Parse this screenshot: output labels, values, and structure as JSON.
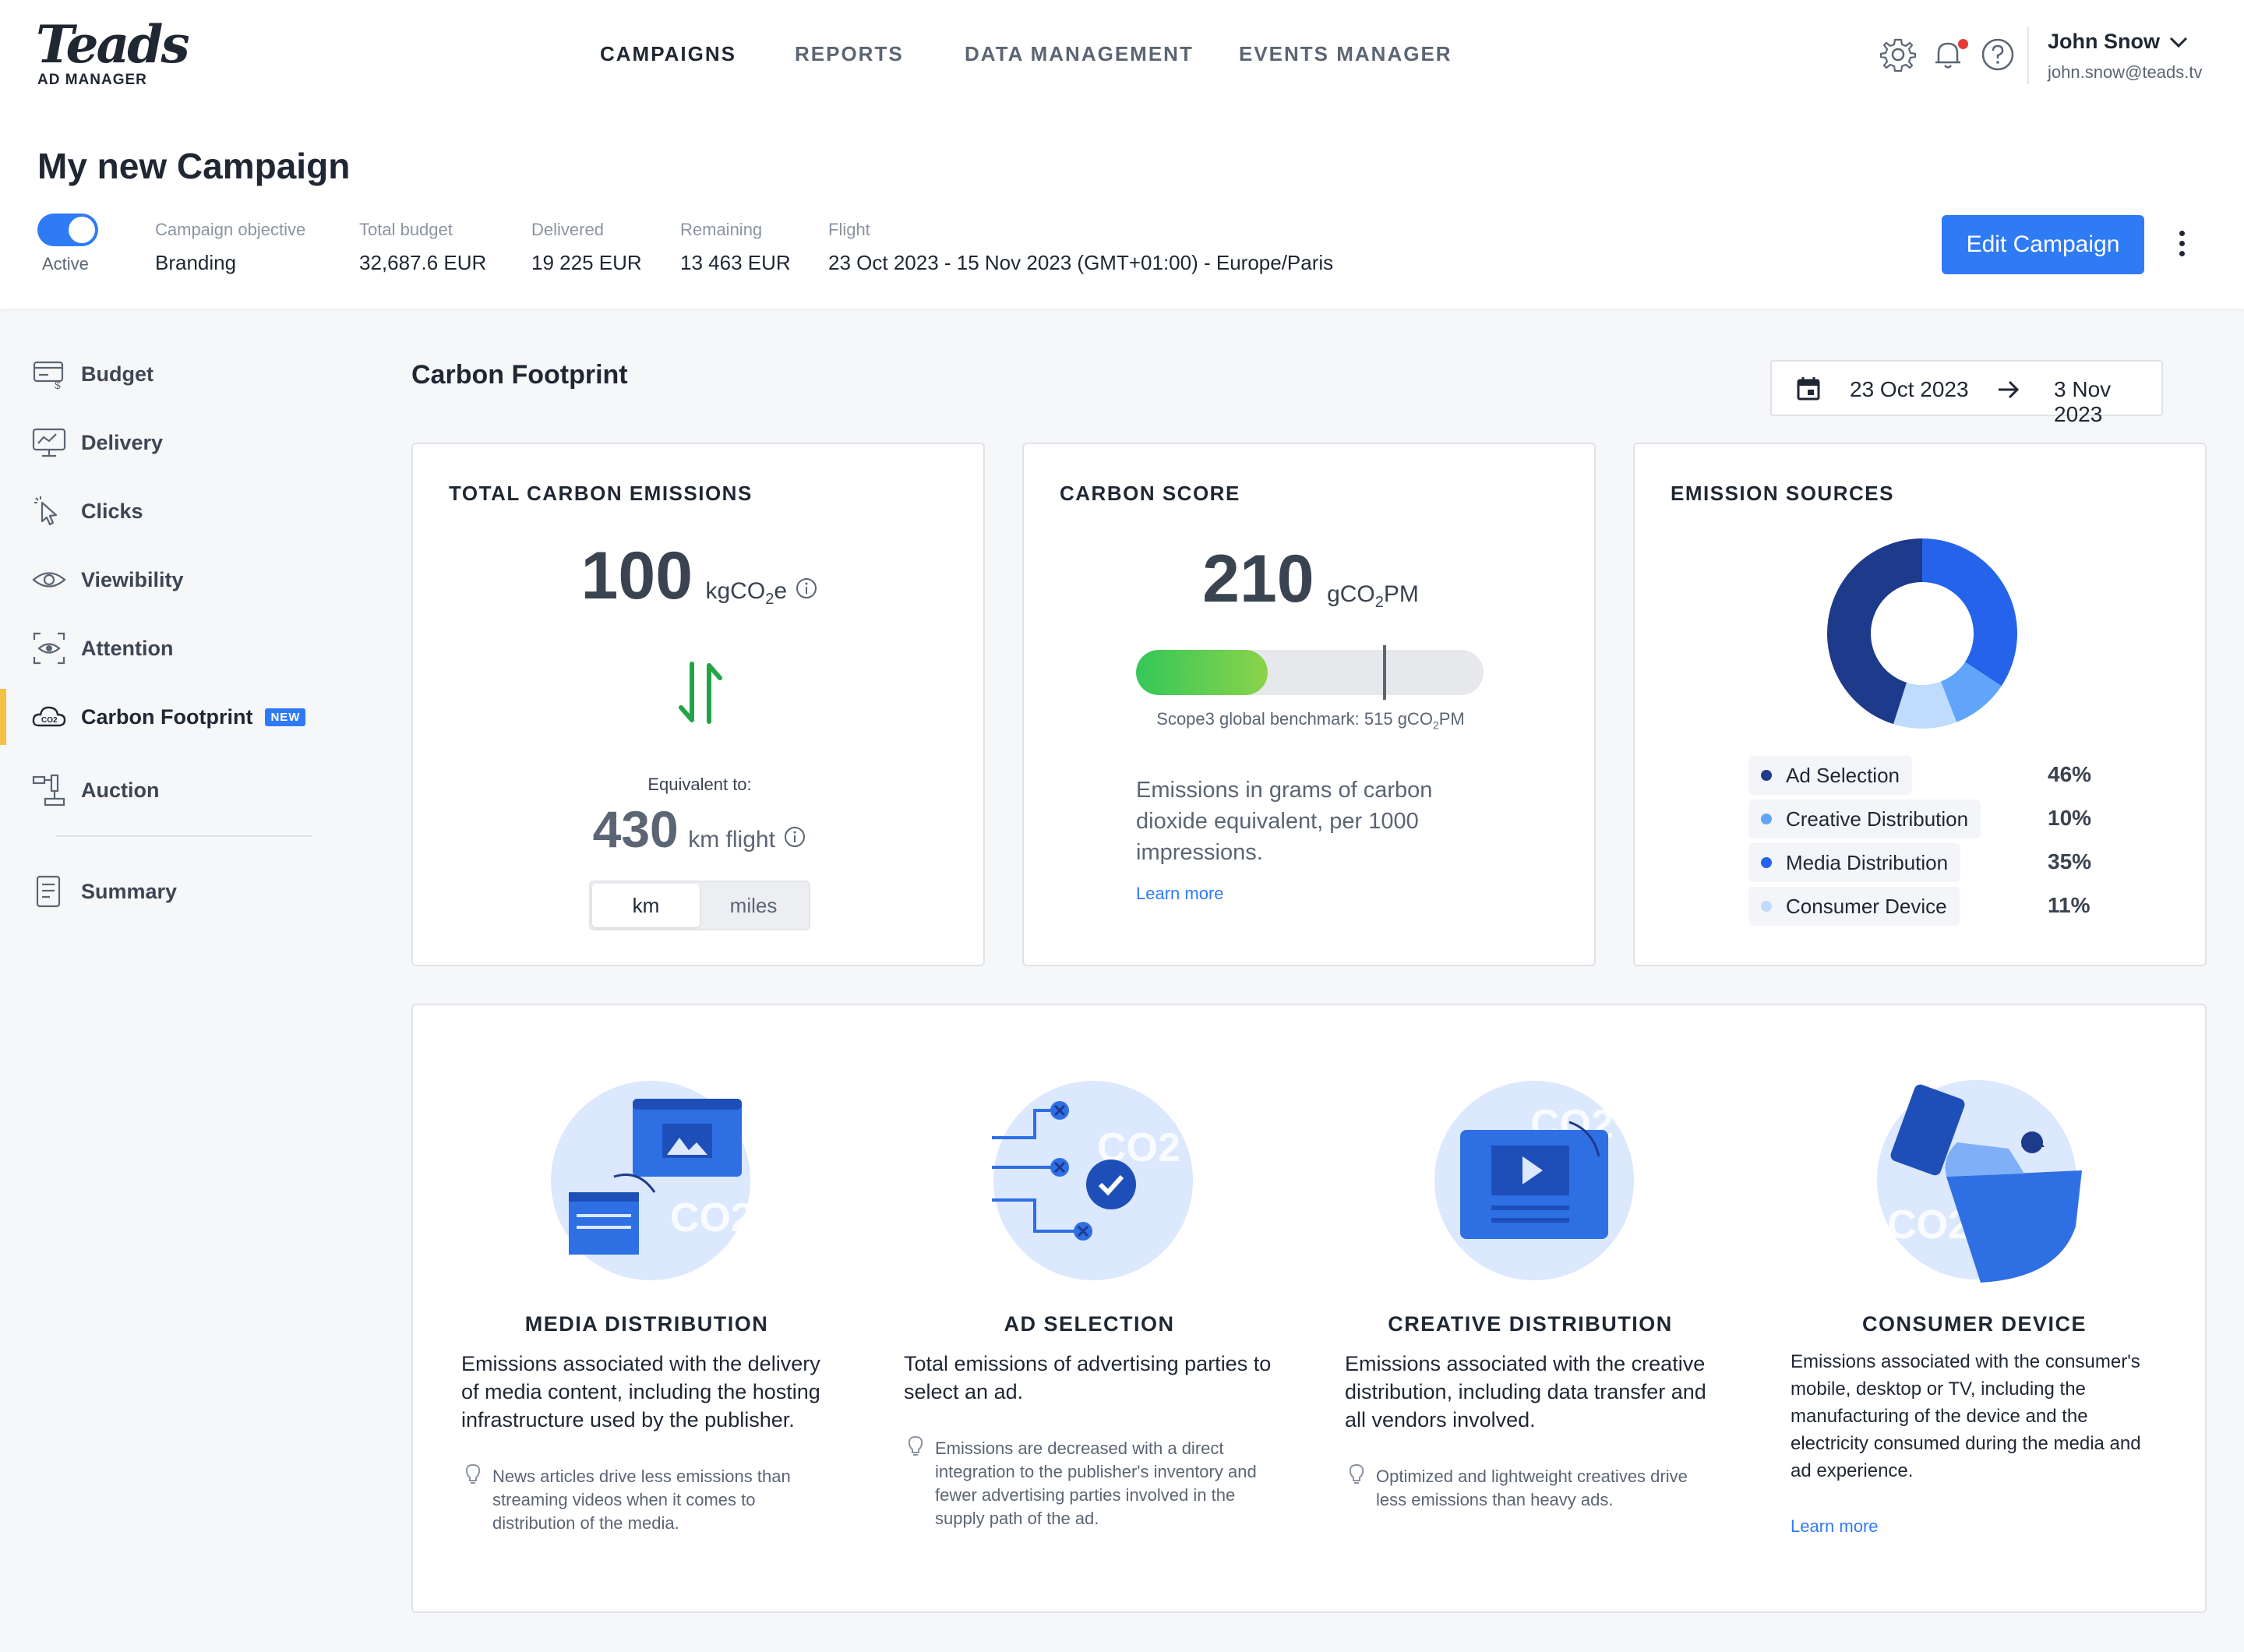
{
  "brand": {
    "logo": "Teads",
    "sub": "AD MANAGER"
  },
  "nav": {
    "items": [
      "CAMPAIGNS",
      "REPORTS",
      "DATA MANAGEMENT",
      "EVENTS MANAGER"
    ],
    "active": "CAMPAIGNS"
  },
  "user": {
    "name": "John Snow",
    "email": "john.snow@teads.tv"
  },
  "campaign": {
    "title": "My new Campaign",
    "status": "Active",
    "objective_label": "Campaign objective",
    "objective": "Branding",
    "budget_label": "Total budget",
    "budget": "32,687.6 EUR",
    "delivered_label": "Delivered",
    "delivered": "19 225 EUR",
    "remaining_label": "Remaining",
    "remaining": "13 463 EUR",
    "flight_label": "Flight",
    "flight": "23 Oct 2023 - 15 Nov 2023 (GMT+01:00) - Europe/Paris",
    "edit_label": "Edit Campaign"
  },
  "sidebar": {
    "items": [
      {
        "label": "Budget",
        "icon": "budget-icon"
      },
      {
        "label": "Delivery",
        "icon": "delivery-icon"
      },
      {
        "label": "Clicks",
        "icon": "cursor-icon"
      },
      {
        "label": "Viewibility",
        "icon": "eye-icon"
      },
      {
        "label": "Attention",
        "icon": "attention-icon"
      },
      {
        "label": "Carbon Footprint",
        "icon": "co2-cloud-icon",
        "badge": "NEW"
      },
      {
        "label": "Auction",
        "icon": "auction-icon"
      },
      {
        "label": "Summary",
        "icon": "summary-icon"
      }
    ],
    "active": "Carbon Footprint"
  },
  "main": {
    "title": "Carbon Footprint",
    "date_from": "23 Oct 2023",
    "date_to": "3 Nov 2023"
  },
  "emissions": {
    "title": "TOTAL CARBON EMISSIONS",
    "value": "100",
    "unit_pre": "kgCO",
    "unit_sub": "2",
    "unit_post": "e",
    "equivalent_label": "Equivalent to:",
    "equivalent_value": "430",
    "equivalent_unit": "km flight",
    "units": [
      "km",
      "miles"
    ],
    "selected_unit": "km"
  },
  "score": {
    "title": "CARBON SCORE",
    "value": "210",
    "unit_pre": "gCO",
    "unit_sub": "2",
    "unit_post": "PM",
    "benchmark_pre": "Scope3 global benchmark: 515 gCO",
    "benchmark_sub": "2",
    "benchmark_post": "PM",
    "progress": 0.38,
    "benchmark_position": 0.71,
    "description": "Emissions in grams of carbon dioxide equivalent, per 1000 impressions.",
    "learn_more": "Learn more",
    "colors": {
      "bar_start": "#34c759",
      "bar_end": "#8bd34a",
      "track": "#e6e8eb"
    }
  },
  "sources": {
    "title": "EMISSION SOURCES",
    "items": [
      {
        "name": "Ad Selection",
        "pct": "46%",
        "value": 46,
        "color": "#1e3a8a"
      },
      {
        "name": "Creative Distribution",
        "pct": "10%",
        "value": 10,
        "color": "#60a5fa"
      },
      {
        "name": "Media Distribution",
        "pct": "35%",
        "value": 35,
        "color": "#2563eb"
      },
      {
        "name": "Consumer Device",
        "pct": "11%",
        "value": 11,
        "color": "#bfdbfe"
      }
    ]
  },
  "info": [
    {
      "title": "MEDIA DISTRIBUTION",
      "desc": "Emissions associated with the delivery of media content, including the hosting infrastructure used by the publisher.",
      "tip": "News articles drive less emissions than streaming videos when it comes to distribution of the media.",
      "illustration": "media-distribution-illustration"
    },
    {
      "title": "AD SELECTION",
      "desc": "Total emissions of advertising parties to select an ad.",
      "tip": "Emissions are decreased with a direct integration to the publisher's inventory and fewer advertising parties involved in the supply path of the ad.",
      "illustration": "ad-selection-illustration"
    },
    {
      "title": "CREATIVE DISTRIBUTION",
      "desc": "Emissions associated with the creative distribution, including data transfer and all vendors involved.",
      "tip": "Optimized and lightweight creatives drive less emissions than heavy ads.",
      "illustration": "creative-distribution-illustration"
    },
    {
      "title": "CONSUMER DEVICE",
      "desc": "Emissions associated with the consumer's mobile, desktop or TV, including the manufacturing of the device and the electricity consumed during the media and ad experience.",
      "link": "Learn more",
      "illustration": "consumer-device-illustration"
    }
  ],
  "illustration_text": "CO2",
  "colors": {
    "accent": "#2f7bf5",
    "active_marker": "#f6c244",
    "notification": "#e53935",
    "arrows": "#22a447"
  }
}
